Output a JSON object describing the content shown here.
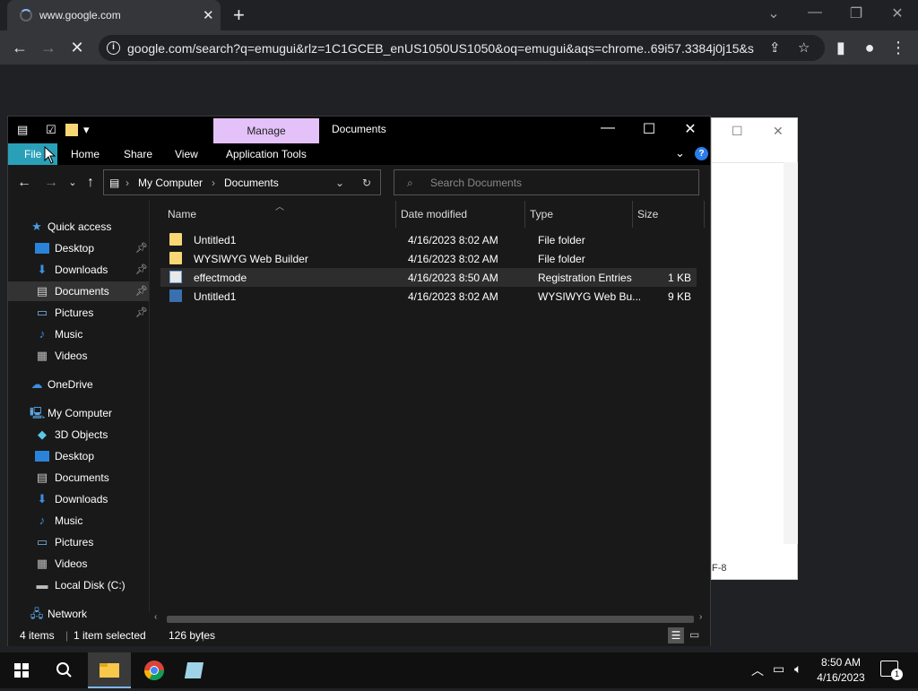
{
  "chrome": {
    "tab_title": "www.google.com",
    "tab_close": "✕",
    "new_tab": "+",
    "url": "google.com/search?q=emugui&rlz=1C1GCEB_enUS1050US1050&oq=emugui&aqs=chrome..69i57.3384j0j15&s...",
    "info": "i"
  },
  "bg_window": {
    "status_text": "F-8"
  },
  "explorer": {
    "title": "Documents",
    "manage_label": "Manage",
    "ribbon": {
      "file": "File",
      "home": "Home",
      "share": "Share",
      "view": "View",
      "app_tools": "Application Tools"
    },
    "breadcrumb": {
      "root": "My Computer",
      "current": "Documents"
    },
    "search_placeholder": "Search Documents",
    "nav": {
      "quick_access": "Quick access",
      "desktop": "Desktop",
      "downloads": "Downloads",
      "documents": "Documents",
      "pictures": "Pictures",
      "music": "Music",
      "videos": "Videos",
      "onedrive": "OneDrive",
      "my_computer": "My Computer",
      "objects3d": "3D Objects",
      "pc_desktop": "Desktop",
      "pc_documents": "Documents",
      "pc_downloads": "Downloads",
      "pc_music": "Music",
      "pc_pictures": "Pictures",
      "pc_videos": "Videos",
      "local_disk": "Local Disk (C:)",
      "network": "Network"
    },
    "columns": {
      "name": "Name",
      "date": "Date modified",
      "type": "Type",
      "size": "Size"
    },
    "files": [
      {
        "name": "Untitled1",
        "date": "4/16/2023 8:02 AM",
        "type": "File folder",
        "size": ""
      },
      {
        "name": "WYSIWYG Web Builder",
        "date": "4/16/2023 8:02 AM",
        "type": "File folder",
        "size": ""
      },
      {
        "name": "effectmode",
        "date": "4/16/2023 8:50 AM",
        "type": "Registration Entries",
        "size": "1 KB"
      },
      {
        "name": "Untitled1",
        "date": "4/16/2023 8:02 AM",
        "type": "WYSIWYG Web Bu...",
        "size": "9 KB"
      }
    ],
    "status": {
      "items": "4 items",
      "selected": "1 item selected",
      "bytes": "126 bytes"
    }
  },
  "taskbar": {
    "time": "8:50 AM",
    "date": "4/16/2023",
    "notifications": "1"
  }
}
